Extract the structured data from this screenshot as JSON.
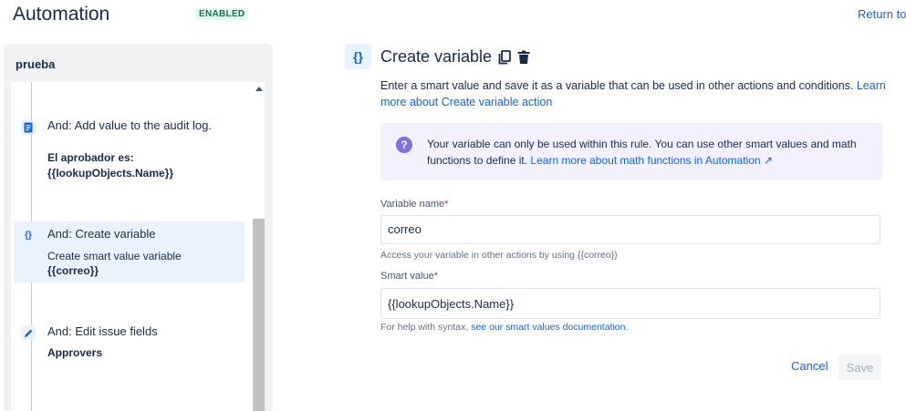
{
  "header": {
    "title": "Automation",
    "status_badge": "ENABLED",
    "return_link": "Return to"
  },
  "sidebar": {
    "rule_name": "prueba",
    "items": [
      {
        "icon": "log-icon",
        "head": "And: Add value to the audit log.",
        "bold": "El aprobador es: {{lookupObjects.Name}}",
        "selected": false
      },
      {
        "icon": "braces-icon",
        "head": "And: Create variable",
        "sub": "Create smart value variable",
        "bold": "{{correo}}",
        "selected": true
      },
      {
        "icon": "pencil-icon",
        "head": "And: Edit issue fields",
        "bold": "Approvers",
        "selected": false
      }
    ]
  },
  "action": {
    "icon": "braces-icon",
    "title": "Create variable",
    "description": "Enter a smart value and save it as a variable that can be used in other actions and conditions.",
    "description_link": "Learn more about Create variable action",
    "info_text": "Your variable can only be used within this rule. You can use other smart values and math functions to define it.",
    "info_link": "Learn more about math functions in Automation ↗",
    "variable_name": {
      "label": "Variable name",
      "required_mark": "*",
      "value": "correo",
      "help": "Access your variable in other actions by using {{correo}}"
    },
    "smart_value": {
      "label": "Smart value",
      "required_mark": "*",
      "value": "{{lookupObjects.Name}}",
      "help_prefix": "For help with syntax,",
      "help_link": "see our smart values documentation",
      "help_suffix": "."
    },
    "cancel_label": "Cancel",
    "save_label": "Save"
  },
  "colors": {
    "accent": "#0c66e4",
    "selected_bg": "#e9f2ff",
    "info_bg": "#f3f0ff",
    "info_icon": "#8270db",
    "badge_text": "#216e4e",
    "badge_bg": "#dcfff1"
  }
}
